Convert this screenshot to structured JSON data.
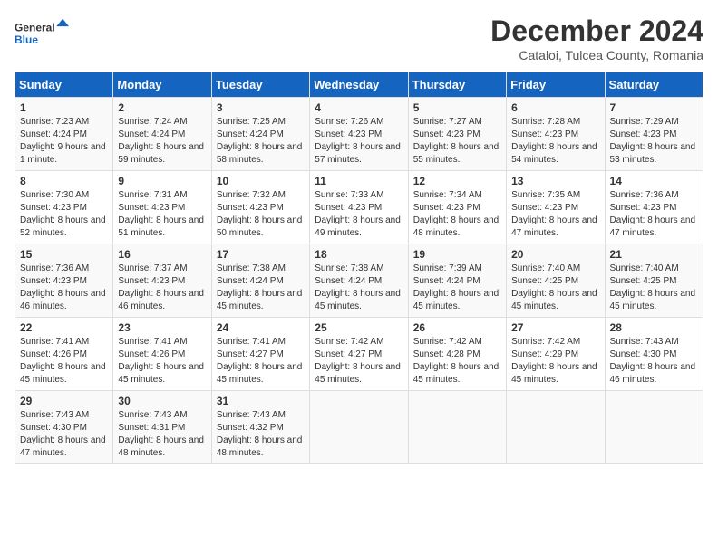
{
  "logo": {
    "general": "General",
    "blue": "Blue"
  },
  "title": "December 2024",
  "subtitle": "Cataloi, Tulcea County, Romania",
  "days_header": [
    "Sunday",
    "Monday",
    "Tuesday",
    "Wednesday",
    "Thursday",
    "Friday",
    "Saturday"
  ],
  "weeks": [
    [
      {
        "day": "1",
        "sunrise": "Sunrise: 7:23 AM",
        "sunset": "Sunset: 4:24 PM",
        "daylight": "Daylight: 9 hours and 1 minute."
      },
      {
        "day": "2",
        "sunrise": "Sunrise: 7:24 AM",
        "sunset": "Sunset: 4:24 PM",
        "daylight": "Daylight: 8 hours and 59 minutes."
      },
      {
        "day": "3",
        "sunrise": "Sunrise: 7:25 AM",
        "sunset": "Sunset: 4:24 PM",
        "daylight": "Daylight: 8 hours and 58 minutes."
      },
      {
        "day": "4",
        "sunrise": "Sunrise: 7:26 AM",
        "sunset": "Sunset: 4:23 PM",
        "daylight": "Daylight: 8 hours and 57 minutes."
      },
      {
        "day": "5",
        "sunrise": "Sunrise: 7:27 AM",
        "sunset": "Sunset: 4:23 PM",
        "daylight": "Daylight: 8 hours and 55 minutes."
      },
      {
        "day": "6",
        "sunrise": "Sunrise: 7:28 AM",
        "sunset": "Sunset: 4:23 PM",
        "daylight": "Daylight: 8 hours and 54 minutes."
      },
      {
        "day": "7",
        "sunrise": "Sunrise: 7:29 AM",
        "sunset": "Sunset: 4:23 PM",
        "daylight": "Daylight: 8 hours and 53 minutes."
      }
    ],
    [
      {
        "day": "8",
        "sunrise": "Sunrise: 7:30 AM",
        "sunset": "Sunset: 4:23 PM",
        "daylight": "Daylight: 8 hours and 52 minutes."
      },
      {
        "day": "9",
        "sunrise": "Sunrise: 7:31 AM",
        "sunset": "Sunset: 4:23 PM",
        "daylight": "Daylight: 8 hours and 51 minutes."
      },
      {
        "day": "10",
        "sunrise": "Sunrise: 7:32 AM",
        "sunset": "Sunset: 4:23 PM",
        "daylight": "Daylight: 8 hours and 50 minutes."
      },
      {
        "day": "11",
        "sunrise": "Sunrise: 7:33 AM",
        "sunset": "Sunset: 4:23 PM",
        "daylight": "Daylight: 8 hours and 49 minutes."
      },
      {
        "day": "12",
        "sunrise": "Sunrise: 7:34 AM",
        "sunset": "Sunset: 4:23 PM",
        "daylight": "Daylight: 8 hours and 48 minutes."
      },
      {
        "day": "13",
        "sunrise": "Sunrise: 7:35 AM",
        "sunset": "Sunset: 4:23 PM",
        "daylight": "Daylight: 8 hours and 47 minutes."
      },
      {
        "day": "14",
        "sunrise": "Sunrise: 7:36 AM",
        "sunset": "Sunset: 4:23 PM",
        "daylight": "Daylight: 8 hours and 47 minutes."
      }
    ],
    [
      {
        "day": "15",
        "sunrise": "Sunrise: 7:36 AM",
        "sunset": "Sunset: 4:23 PM",
        "daylight": "Daylight: 8 hours and 46 minutes."
      },
      {
        "day": "16",
        "sunrise": "Sunrise: 7:37 AM",
        "sunset": "Sunset: 4:23 PM",
        "daylight": "Daylight: 8 hours and 46 minutes."
      },
      {
        "day": "17",
        "sunrise": "Sunrise: 7:38 AM",
        "sunset": "Sunset: 4:24 PM",
        "daylight": "Daylight: 8 hours and 45 minutes."
      },
      {
        "day": "18",
        "sunrise": "Sunrise: 7:38 AM",
        "sunset": "Sunset: 4:24 PM",
        "daylight": "Daylight: 8 hours and 45 minutes."
      },
      {
        "day": "19",
        "sunrise": "Sunrise: 7:39 AM",
        "sunset": "Sunset: 4:24 PM",
        "daylight": "Daylight: 8 hours and 45 minutes."
      },
      {
        "day": "20",
        "sunrise": "Sunrise: 7:40 AM",
        "sunset": "Sunset: 4:25 PM",
        "daylight": "Daylight: 8 hours and 45 minutes."
      },
      {
        "day": "21",
        "sunrise": "Sunrise: 7:40 AM",
        "sunset": "Sunset: 4:25 PM",
        "daylight": "Daylight: 8 hours and 45 minutes."
      }
    ],
    [
      {
        "day": "22",
        "sunrise": "Sunrise: 7:41 AM",
        "sunset": "Sunset: 4:26 PM",
        "daylight": "Daylight: 8 hours and 45 minutes."
      },
      {
        "day": "23",
        "sunrise": "Sunrise: 7:41 AM",
        "sunset": "Sunset: 4:26 PM",
        "daylight": "Daylight: 8 hours and 45 minutes."
      },
      {
        "day": "24",
        "sunrise": "Sunrise: 7:41 AM",
        "sunset": "Sunset: 4:27 PM",
        "daylight": "Daylight: 8 hours and 45 minutes."
      },
      {
        "day": "25",
        "sunrise": "Sunrise: 7:42 AM",
        "sunset": "Sunset: 4:27 PM",
        "daylight": "Daylight: 8 hours and 45 minutes."
      },
      {
        "day": "26",
        "sunrise": "Sunrise: 7:42 AM",
        "sunset": "Sunset: 4:28 PM",
        "daylight": "Daylight: 8 hours and 45 minutes."
      },
      {
        "day": "27",
        "sunrise": "Sunrise: 7:42 AM",
        "sunset": "Sunset: 4:29 PM",
        "daylight": "Daylight: 8 hours and 45 minutes."
      },
      {
        "day": "28",
        "sunrise": "Sunrise: 7:43 AM",
        "sunset": "Sunset: 4:30 PM",
        "daylight": "Daylight: 8 hours and 46 minutes."
      }
    ],
    [
      {
        "day": "29",
        "sunrise": "Sunrise: 7:43 AM",
        "sunset": "Sunset: 4:30 PM",
        "daylight": "Daylight: 8 hours and 47 minutes."
      },
      {
        "day": "30",
        "sunrise": "Sunrise: 7:43 AM",
        "sunset": "Sunset: 4:31 PM",
        "daylight": "Daylight: 8 hours and 48 minutes."
      },
      {
        "day": "31",
        "sunrise": "Sunrise: 7:43 AM",
        "sunset": "Sunset: 4:32 PM",
        "daylight": "Daylight: 8 hours and 48 minutes."
      },
      null,
      null,
      null,
      null
    ]
  ]
}
